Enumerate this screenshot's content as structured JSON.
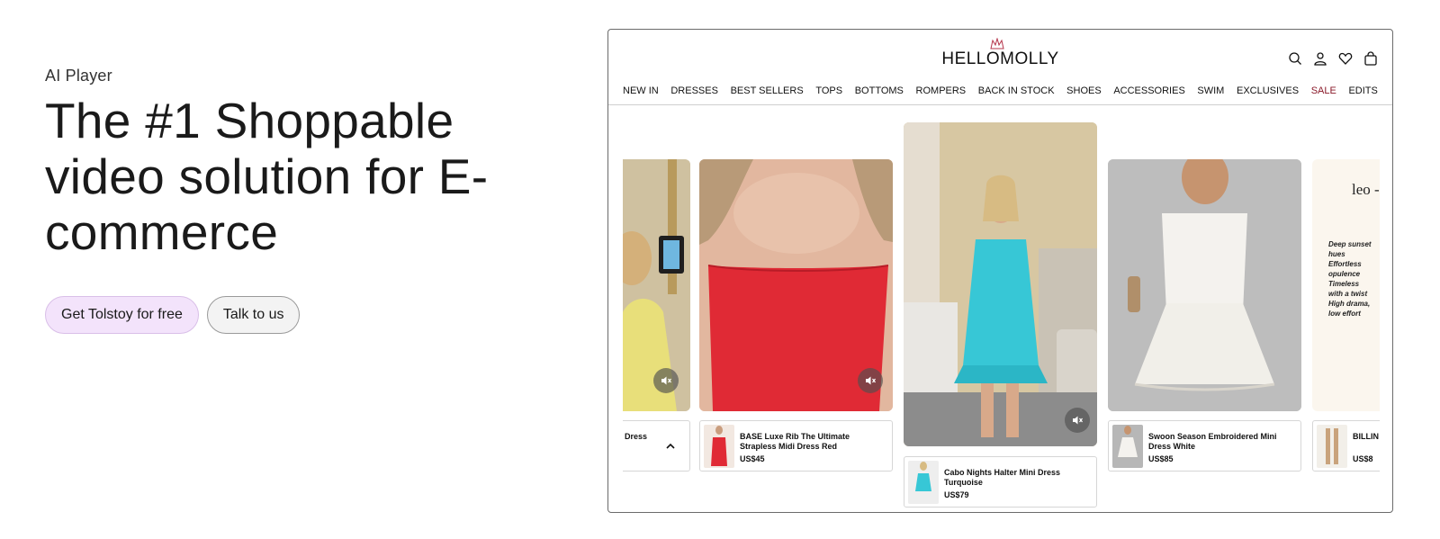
{
  "hero": {
    "eyebrow": "AI Player",
    "headline": "The #1 Shoppable video solution for E-commerce",
    "primary_cta": "Get Tolstoy for free",
    "secondary_cta": "Talk to us"
  },
  "store": {
    "logo": "HELLOMOLLY",
    "icons": [
      "search-icon",
      "account-icon",
      "heart-icon",
      "bag-icon"
    ],
    "nav": [
      "NEW IN",
      "DRESSES",
      "BEST SELLERS",
      "TOPS",
      "BOTTOMS",
      "ROMPERS",
      "BACK IN STOCK",
      "SHOES",
      "ACCESSORIES",
      "SWIM",
      "EXCLUSIVES",
      "SALE",
      "EDITS"
    ],
    "sale_color": "#8a1a2a"
  },
  "carousel": {
    "promo_text": {
      "brand": "leo - g",
      "bullets": [
        "Deep sunset hues",
        "Effortless opulence",
        "Timeless with a twist",
        "High drama, low effort"
      ]
    },
    "products": [
      {
        "name": "ini Dress",
        "price": ""
      },
      {
        "name": "BASE Luxe Rib The Ultimate Strapless Midi Dress Red",
        "price": "US$45"
      },
      {
        "name": "Cabo Nights Halter Mini Dress Turquoise",
        "price": "US$79"
      },
      {
        "name": "Swoon Season Embroidered Mini Dress White",
        "price": "US$85"
      },
      {
        "name": "BILLIN",
        "price": "US$8"
      }
    ]
  }
}
